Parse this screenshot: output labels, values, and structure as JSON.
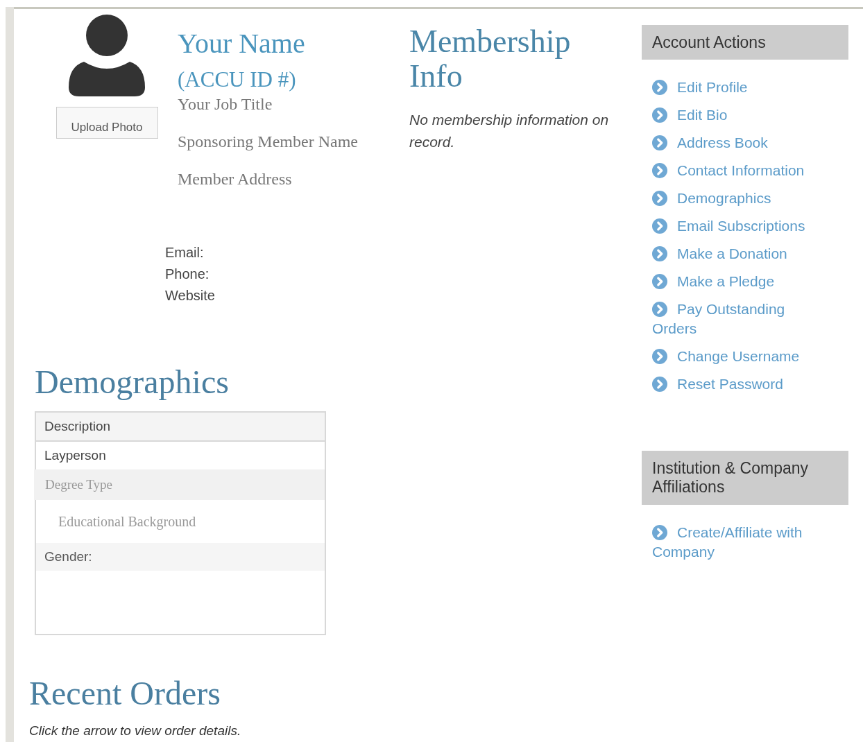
{
  "profile": {
    "upload_button": "Upload Photo",
    "name": "Your Name",
    "id": "(ACCU ID #)",
    "details": [
      "Your Job Title",
      "Sponsoring Member Name",
      "Member Address"
    ],
    "contact": [
      "Email:",
      "Phone:",
      "Website"
    ]
  },
  "membership": {
    "title": "Membership Info",
    "message": "No membership information on record."
  },
  "demographics": {
    "title": "Demographics",
    "rows": [
      {
        "kind": "header",
        "text": "Description"
      },
      {
        "kind": "plain",
        "text": "Layperson"
      },
      {
        "kind": "serif-shaded",
        "text": "Degree Type"
      },
      {
        "kind": "serif-indented",
        "text": "Educational Background"
      },
      {
        "kind": "shaded",
        "text": "Gender:"
      }
    ]
  },
  "recent_orders": {
    "title": "Recent Orders",
    "note": "Click the arrow to view order details."
  },
  "account_actions": {
    "title": "Account Actions",
    "items": [
      "Edit Profile",
      "Edit Bio",
      "Address Book",
      "Contact Information",
      "Demographics",
      "Email Subscriptions",
      "Make a Donation",
      "Make a Pledge",
      "Pay Outstanding Orders",
      "Change Username",
      "Reset Password"
    ]
  },
  "affiliations": {
    "title": "Institution & Company Affiliations",
    "items": [
      "Create/Affiliate with Company"
    ]
  }
}
